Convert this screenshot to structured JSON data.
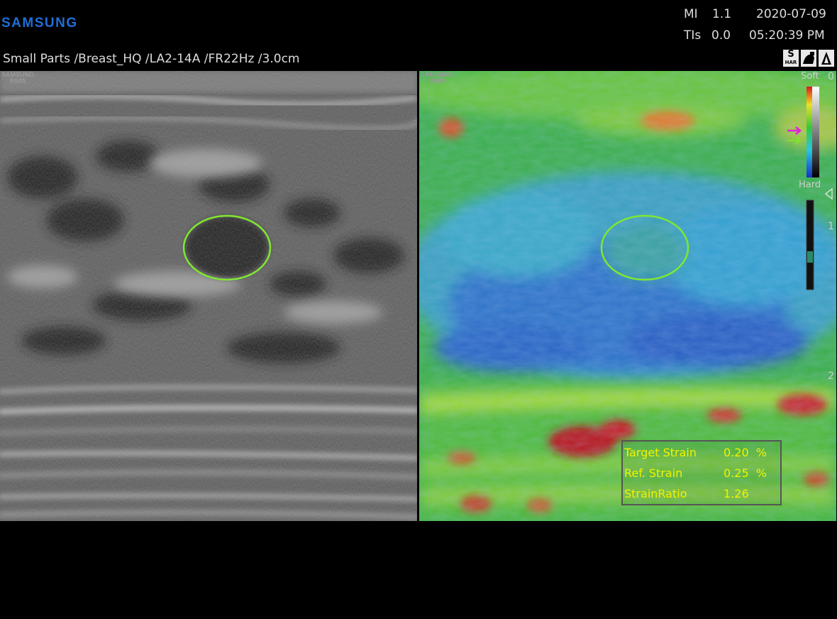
{
  "brand": "SAMSUNG",
  "header": {
    "mi_label": "MI",
    "mi_value": "1.1",
    "tis_label": "TIs",
    "tis_value": "0.0",
    "date": "2020-07-09",
    "time": "05:20:39 PM"
  },
  "preset": {
    "text": "Small Parts /Breast_HQ /LA2-14A /FR22Hz /3.0cm"
  },
  "toolbar": {
    "s_har_label": "S",
    "s_har_sub": "HAR",
    "probe_icon": "probe-icon",
    "marker_icon": "marker-icon"
  },
  "watermark": {
    "line1": "SAMSUNG",
    "line2": "RS85"
  },
  "elasto_scale": {
    "soft_label": "Soft",
    "hard_label": "Hard"
  },
  "depth_marks": [
    "0",
    "1",
    "2"
  ],
  "strain": {
    "target_label": "Target Strain",
    "target_value": "0.20  %",
    "ref_label": "Ref. Strain",
    "ref_value": "0.25  %",
    "ratio_label": "StrainRatio",
    "ratio_value": "1.26"
  },
  "colors": {
    "roi_ellipse": "#7fe830",
    "brand_blue": "#1f6fd6",
    "readout_yellow": "#f2f200"
  }
}
